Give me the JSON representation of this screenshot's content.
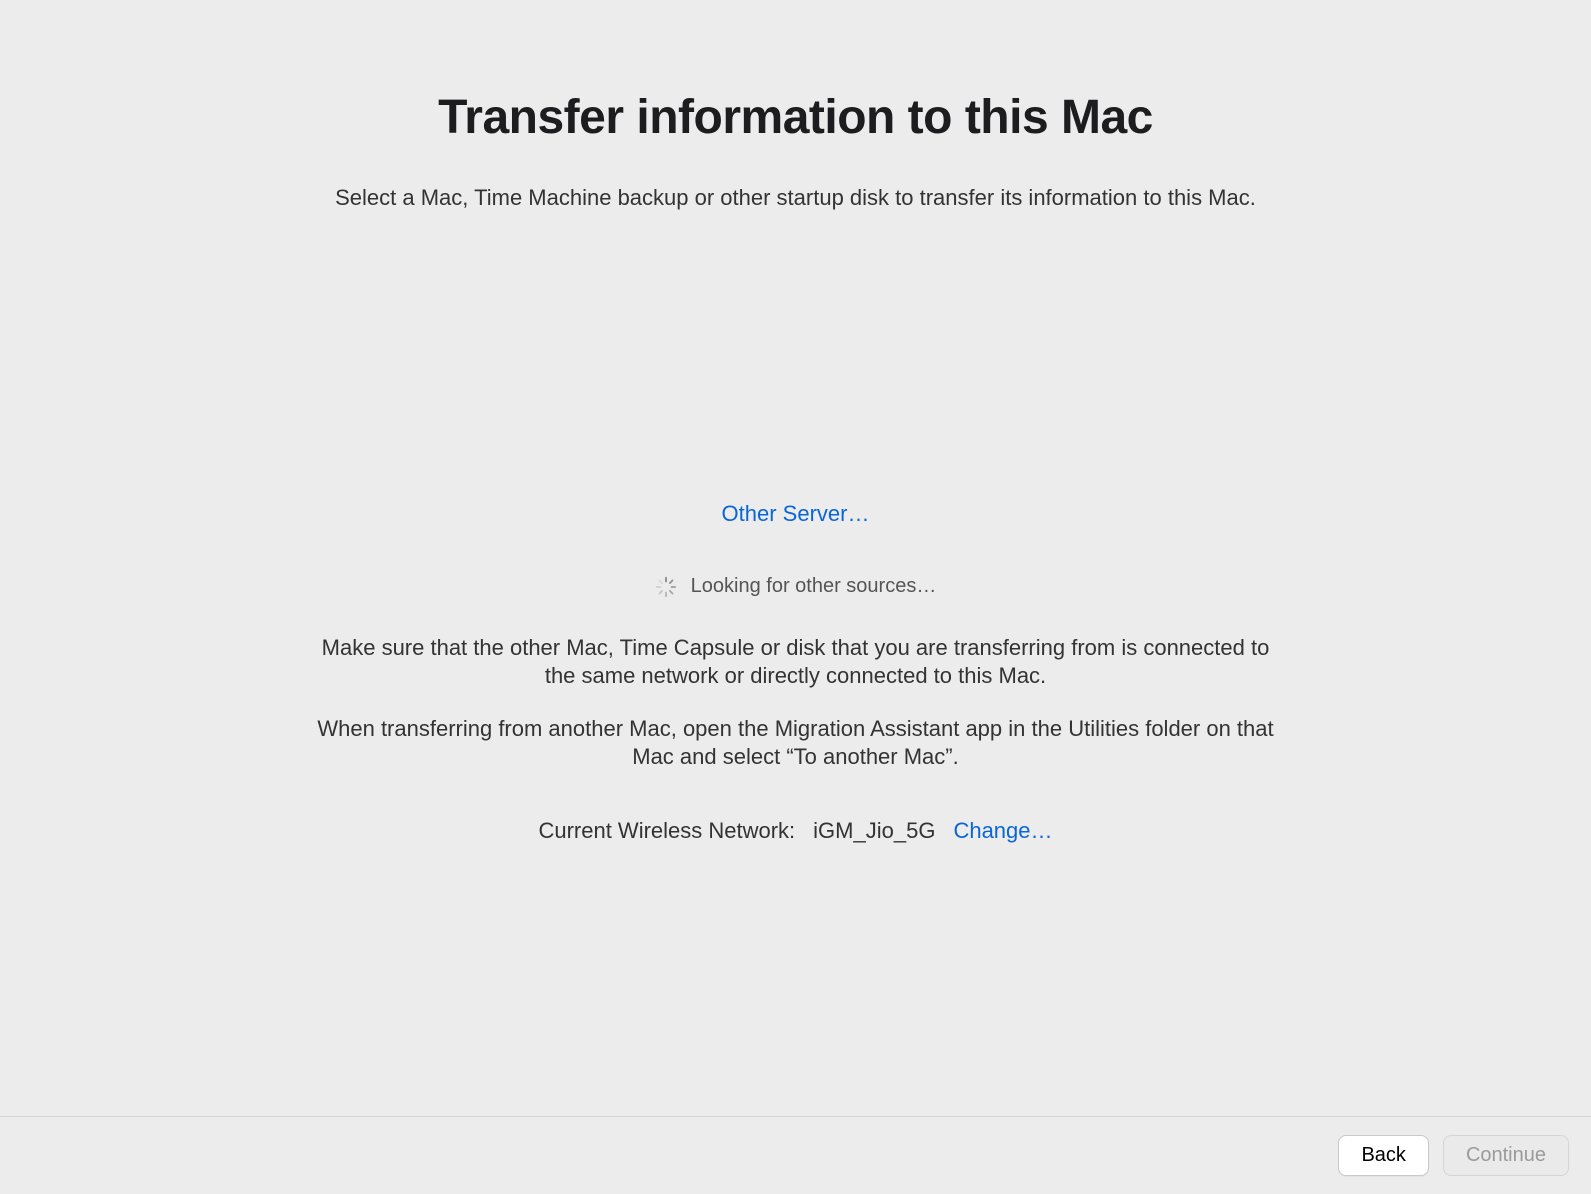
{
  "title": "Transfer information to this Mac",
  "subtitle": "Select a Mac, Time Machine backup or other startup disk to transfer its information to this Mac.",
  "other_server_link": "Other Server…",
  "status_text": "Looking for other sources…",
  "help_para_1": "Make sure that the other Mac, Time Capsule or disk that you are transferring from is connected to the same network or directly connected to this Mac.",
  "help_para_2": "When transferring from another Mac, open the Migration Assistant app in the Utilities folder on that Mac and select “To another Mac”.",
  "network": {
    "label": "Current Wireless Network:",
    "value": "iGM_Jio_5G",
    "change_link": "Change…"
  },
  "buttons": {
    "back": "Back",
    "continue": "Continue"
  }
}
